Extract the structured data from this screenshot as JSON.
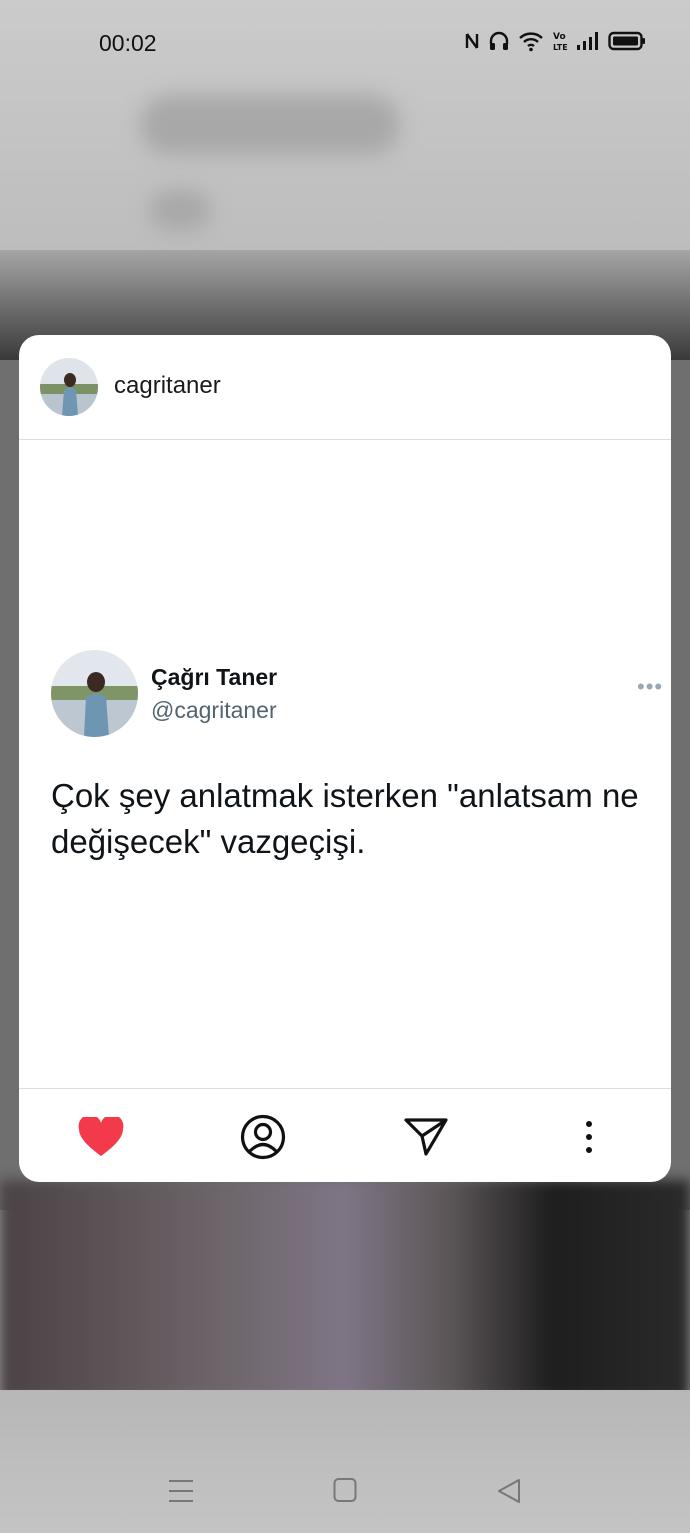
{
  "status_bar": {
    "time": "00:02",
    "icons": [
      "nfc-icon",
      "headphones-icon",
      "wifi-icon",
      "volte-icon",
      "signal-icon",
      "battery-icon"
    ]
  },
  "card": {
    "username": "cagritaner",
    "tweet": {
      "display_name": "Çağrı Taner",
      "handle": "@cagritaner",
      "more": "•••",
      "text": "Çok şey anlatmak isterken \"anlatsam ne değişecek\" vazgeçişi."
    },
    "actions": [
      "heart-icon",
      "profile-icon",
      "send-icon",
      "more-vertical-icon"
    ],
    "colors": {
      "heart": "#f23a4b"
    }
  },
  "nav_bar": {
    "buttons": [
      "menu-icon",
      "home-icon",
      "back-icon"
    ]
  }
}
